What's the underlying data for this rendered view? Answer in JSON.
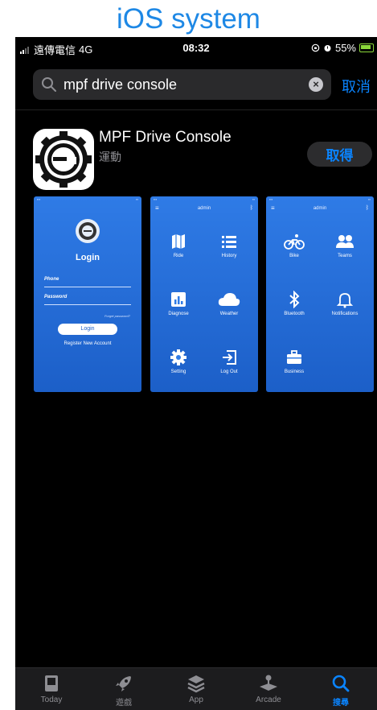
{
  "caption": "iOS system",
  "status_bar": {
    "carrier": "遠傳電信",
    "network": "4G",
    "time": "08:32",
    "battery": "55%"
  },
  "search": {
    "query": "mpf drive console",
    "cancel_label": "取消"
  },
  "result": {
    "app_name": "MPF Drive Console",
    "category": "運動",
    "get_label": "取得",
    "screenshots": {
      "login": {
        "title": "Login",
        "phone_label": "Phone",
        "password_label": "Password",
        "forgot_label": "Forget password?",
        "button_label": "Login",
        "register_label": "Register New Account"
      },
      "menu1": {
        "nav_title": "admin",
        "items": [
          "Ride",
          "History",
          "Diagnose",
          "Weather",
          "Setting",
          "Log Out"
        ]
      },
      "menu2": {
        "nav_title": "admin",
        "items": [
          "Bike",
          "Teams",
          "Bluetooth",
          "Notifications",
          "Business"
        ]
      }
    }
  },
  "tab_bar": {
    "items": [
      {
        "label": "Today",
        "icon": "today-icon"
      },
      {
        "label": "遊戲",
        "icon": "rocket-icon"
      },
      {
        "label": "App",
        "icon": "layers-icon"
      },
      {
        "label": "Arcade",
        "icon": "joystick-icon"
      },
      {
        "label": "搜尋",
        "icon": "search-icon"
      }
    ],
    "active_index": 4
  },
  "colors": {
    "accent": "#0a84ff",
    "caption": "#1e88e5",
    "screenshot_blue": "#2f7be6",
    "battery": "#8bd93a"
  }
}
